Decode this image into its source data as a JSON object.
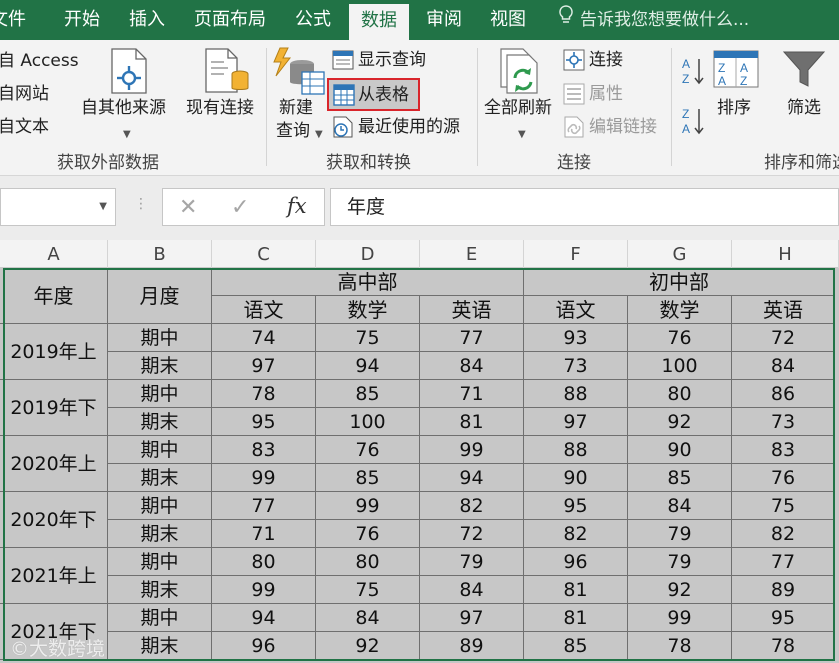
{
  "tabs": [
    {
      "label": "文件",
      "active": false
    },
    {
      "label": "开始",
      "active": false
    },
    {
      "label": "插入",
      "active": false
    },
    {
      "label": "页面布局",
      "active": false
    },
    {
      "label": "公式",
      "active": false
    },
    {
      "label": "数据",
      "active": true
    },
    {
      "label": "审阅",
      "active": false
    },
    {
      "label": "视图",
      "active": false
    }
  ],
  "tell_me": {
    "text": "告诉我您想要做什么...",
    "icon": "lightbulb-icon"
  },
  "ribbon": {
    "get_external": {
      "from_access": "自 Access",
      "from_web": "自网站",
      "from_text": "自文本",
      "from_other": "自其他来源",
      "existing_connections": "现有连接",
      "label": "获取外部数据"
    },
    "get_transform": {
      "new_query_line1": "新建",
      "new_query_line2": "查询",
      "show_queries": "显示查询",
      "from_table": "从表格",
      "recent_sources": "最近使用的源",
      "label": "获取和转换"
    },
    "connections": {
      "refresh_all": "全部刷新",
      "connections": "连接",
      "properties": "属性",
      "edit_links": "编辑链接",
      "label": "连接"
    },
    "sort_filter": {
      "sort": "排序",
      "filter": "筛选",
      "label": "排序和筛选"
    }
  },
  "formula_bar": {
    "name_box": "",
    "fx": "fx",
    "value": "年度"
  },
  "columns": [
    "A",
    "B",
    "C",
    "D",
    "E",
    "F",
    "G",
    "H"
  ],
  "table": {
    "header_year": "年度",
    "header_term": "月度",
    "group_high": "高中部",
    "group_middle": "初中部",
    "subjects": [
      "语文",
      "数学",
      "英语",
      "语文",
      "数学",
      "英语"
    ],
    "years": [
      {
        "year": "2019年上",
        "rows": [
          {
            "term": "期中",
            "scores": [
              "74",
              "75",
              "77",
              "93",
              "76",
              "72"
            ]
          },
          {
            "term": "期末",
            "scores": [
              "97",
              "94",
              "84",
              "73",
              "100",
              "84"
            ]
          }
        ]
      },
      {
        "year": "2019年下",
        "rows": [
          {
            "term": "期中",
            "scores": [
              "78",
              "85",
              "71",
              "88",
              "80",
              "86"
            ]
          },
          {
            "term": "期末",
            "scores": [
              "95",
              "100",
              "81",
              "97",
              "92",
              "73"
            ]
          }
        ]
      },
      {
        "year": "2020年上",
        "rows": [
          {
            "term": "期中",
            "scores": [
              "83",
              "76",
              "99",
              "88",
              "90",
              "83"
            ]
          },
          {
            "term": "期末",
            "scores": [
              "99",
              "85",
              "94",
              "90",
              "85",
              "76"
            ]
          }
        ]
      },
      {
        "year": "2020年下",
        "rows": [
          {
            "term": "期中",
            "scores": [
              "77",
              "99",
              "82",
              "95",
              "84",
              "75"
            ]
          },
          {
            "term": "期末",
            "scores": [
              "71",
              "76",
              "72",
              "82",
              "79",
              "82"
            ]
          }
        ]
      },
      {
        "year": "2021年上",
        "rows": [
          {
            "term": "期中",
            "scores": [
              "80",
              "80",
              "79",
              "96",
              "79",
              "77"
            ]
          },
          {
            "term": "期末",
            "scores": [
              "99",
              "75",
              "84",
              "81",
              "92",
              "89"
            ]
          }
        ]
      },
      {
        "year": "2021年下",
        "rows": [
          {
            "term": "期中",
            "scores": [
              "94",
              "84",
              "97",
              "81",
              "99",
              "95"
            ]
          },
          {
            "term": "期末",
            "scores": [
              "96",
              "92",
              "89",
              "85",
              "78",
              "78"
            ]
          }
        ]
      }
    ]
  },
  "watermark": "大数跨境",
  "colors": {
    "excel_green": "#217346",
    "cell_fill": "#c7c7c7",
    "highlight_red": "#d9252b"
  }
}
